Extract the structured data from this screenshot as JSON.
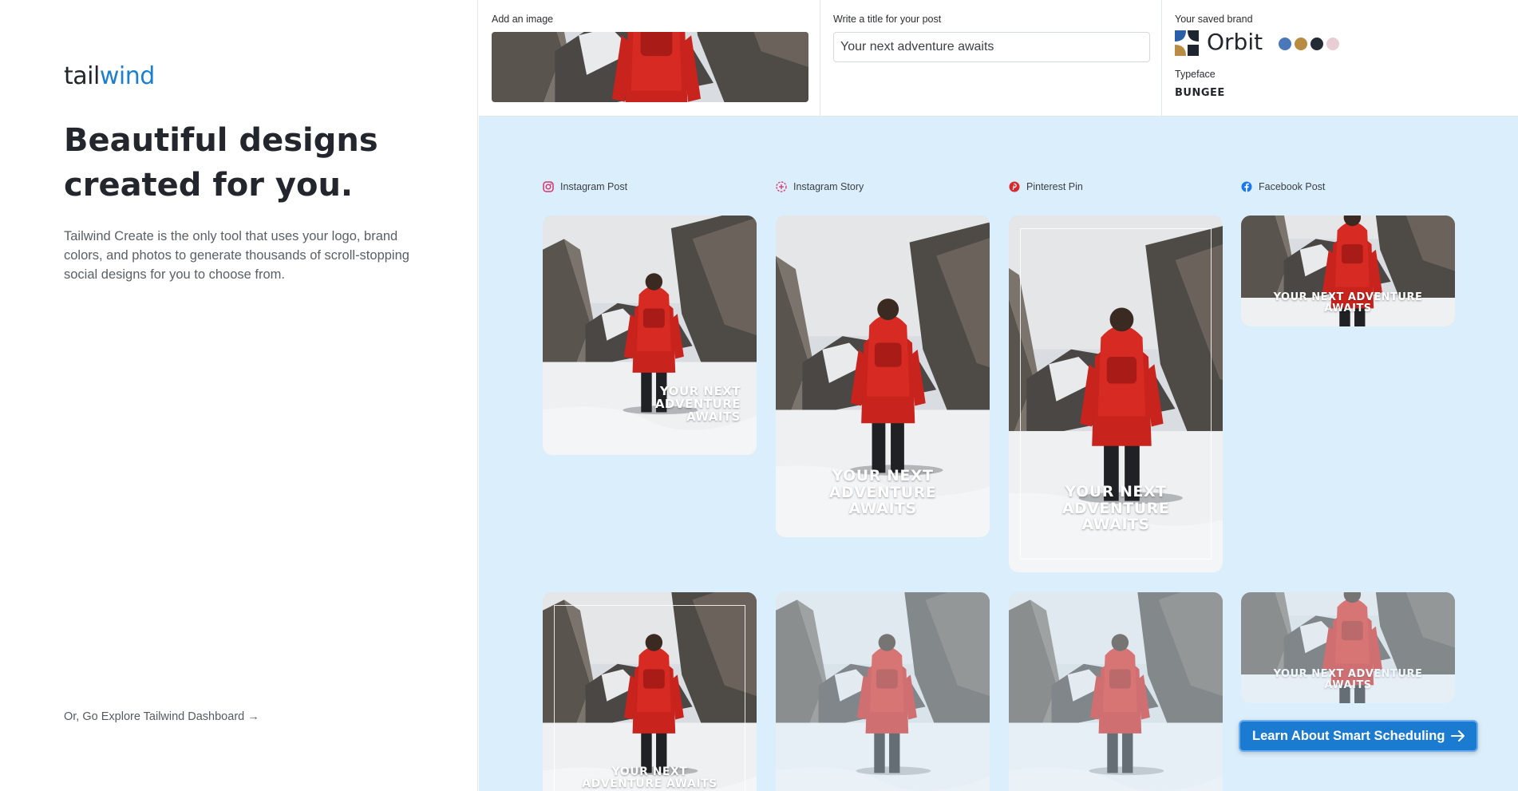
{
  "left": {
    "logo": {
      "part1": "tail",
      "part2": "wind"
    },
    "title": "Beautiful designs created for you.",
    "description": "Tailwind Create is the only tool that uses your logo, brand colors, and photos to generate thousands of scroll-stopping social designs for you to choose from.",
    "explore_link": "Or, Go Explore Tailwind Dashboard →"
  },
  "topbar": {
    "image_label": "Add an image",
    "title_label": "Write a title for your post",
    "title_value": "Your next adventure awaits",
    "brand_label": "Your saved brand",
    "brand_name": "Orbit",
    "brand_colors": [
      "#4a78b8",
      "#b88d43",
      "#242b35",
      "#e9cdd4"
    ],
    "typeface_label": "Typeface",
    "typeface_value": "BUNGEE"
  },
  "columns": [
    {
      "label": "Instagram Post",
      "icon": "instagram-icon",
      "color": "#d6336c"
    },
    {
      "label": "Instagram Story",
      "icon": "instagram-story-icon",
      "color": "#d6336c"
    },
    {
      "label": "Pinterest Pin",
      "icon": "pinterest-icon",
      "color": "#d52b30"
    },
    {
      "label": "Facebook Post",
      "icon": "facebook-icon",
      "color": "#1877f2"
    }
  ],
  "cards": [
    {
      "text": "Your next adventure awaits",
      "format": "instagram-post"
    },
    {
      "text": "Your next adventure awaits",
      "format": "instagram-story"
    },
    {
      "text": "Your next adventure awaits",
      "format": "pinterest-pin"
    },
    {
      "text": "Your next adventure awaits",
      "format": "facebook-post"
    },
    {
      "text": "Your next adventure awaits",
      "format": "instagram-post"
    },
    {
      "text": "",
      "format": "instagram-story"
    },
    {
      "text": "",
      "format": "pinterest-pin"
    },
    {
      "text": "Your next adventure awaits",
      "format": "facebook-post"
    }
  ],
  "cta": {
    "label": "Learn About Smart Scheduling",
    "icon": "arrow-right-icon"
  },
  "colors": {
    "accent": "#1b7bd1",
    "panel_bg": "#dbeefb"
  }
}
